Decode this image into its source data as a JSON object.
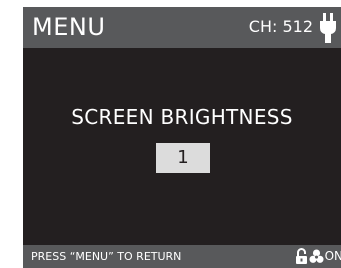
{
  "header": {
    "title": "MENU",
    "channel": "CH: 512",
    "power_icon": "plug-icon"
  },
  "main": {
    "setting_title": "SCREEN BRIGHTNESS",
    "setting_value": "1"
  },
  "footer": {
    "hint": "PRESS “MENU” TO RETURN",
    "lock_icon": "unlock-icon",
    "fan_icon": "fan-icon",
    "fan_state": "ON"
  },
  "colors": {
    "screen_background": "#231f20",
    "bar_background": "#58595b",
    "text": "#ffffff",
    "value_box": "#dcdcdc"
  }
}
